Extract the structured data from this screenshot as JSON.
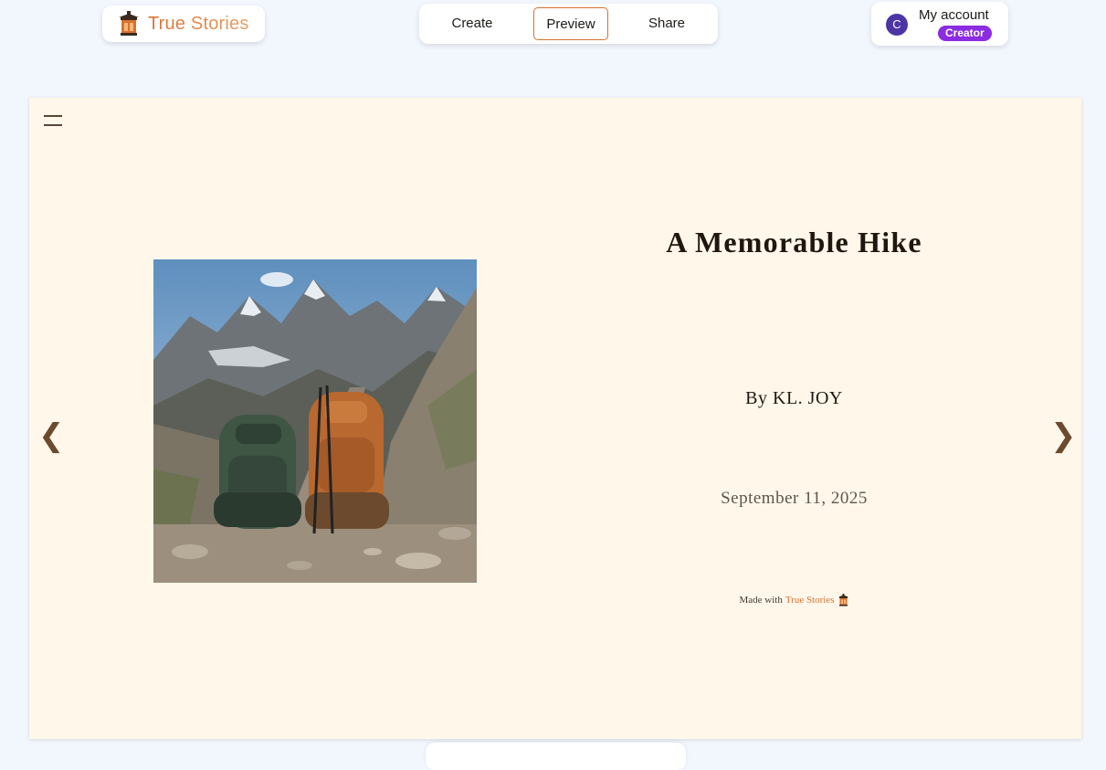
{
  "app": {
    "brand_name": "True Stories",
    "brand_colors": [
      "#d9712e",
      "#e8a067"
    ]
  },
  "mode_tabs": [
    {
      "label": "Create",
      "active": false
    },
    {
      "label": "Preview",
      "active": true
    },
    {
      "label": "Share",
      "active": false
    }
  ],
  "account": {
    "avatar_initial": "C",
    "label": "My account",
    "role": "Creator"
  },
  "story": {
    "title": "A Memorable Hike",
    "author": "By KL. JOY",
    "date": "September 11, 2025",
    "made_with_prefix": "Made with",
    "made_with_brand": "True Stories",
    "cover_description": "Two hiking backpacks on a rocky mountain trail with snowy peaks"
  },
  "navigation": {
    "prev_glyph": "❮",
    "next_glyph": "❯"
  },
  "icons": [
    "lantern-logo-icon",
    "menu-icon",
    "chevron-left-icon",
    "chevron-right-icon"
  ]
}
